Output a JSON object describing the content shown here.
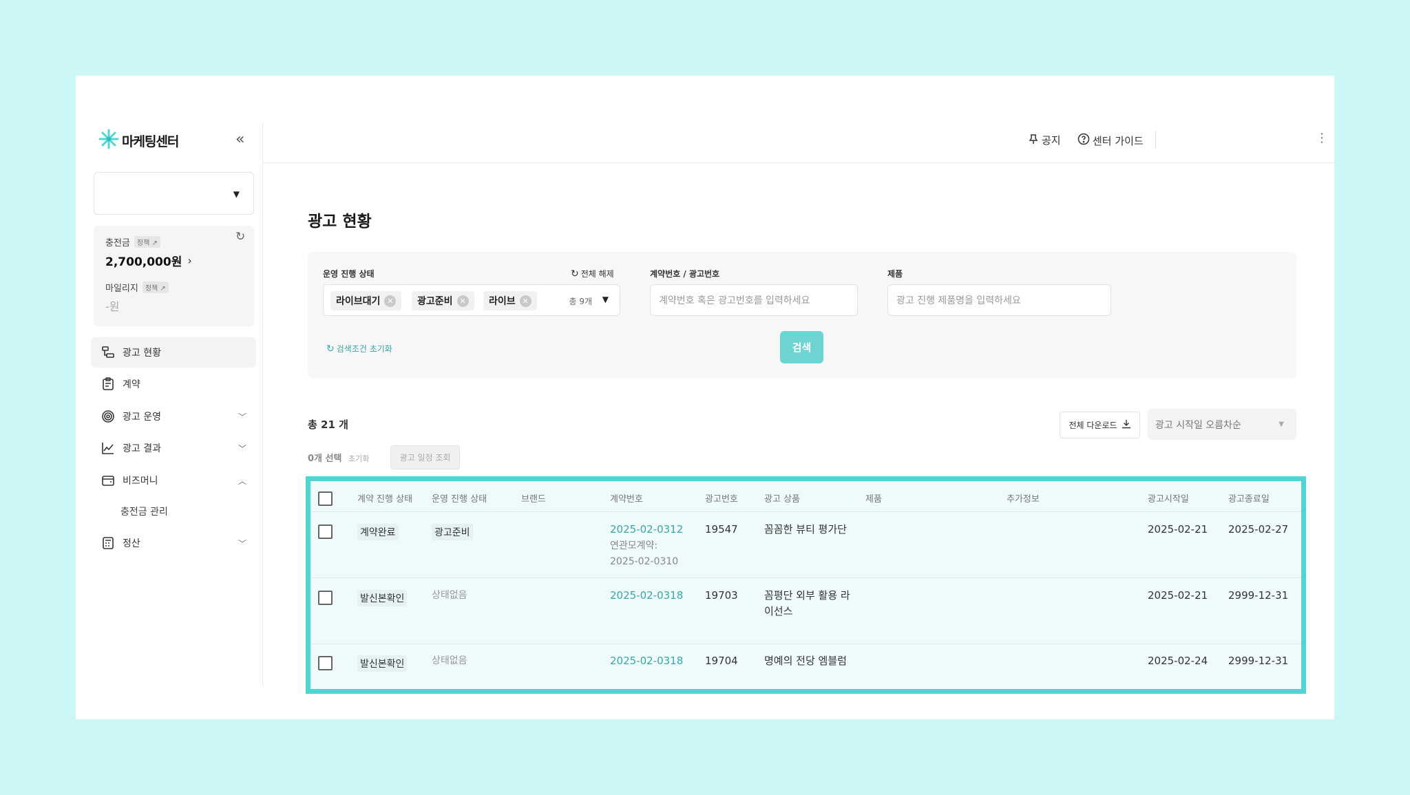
{
  "app": {
    "logo_text": "마케팅센터",
    "brand_color": "#4fd6d4"
  },
  "header": {
    "notice_label": "공지",
    "guide_label": "센터 가이드"
  },
  "sidebar": {
    "account_select_value": "",
    "balance": {
      "charge_label": "충전금",
      "charge_tag": "정책 ↗",
      "charge_amount": "2,700,000원",
      "mileage_label": "마일리지",
      "mileage_tag": "정책 ↗",
      "mileage_amount": "-원"
    },
    "items": [
      {
        "label": "광고 현황",
        "icon": "ad-status-icon",
        "active": true
      },
      {
        "label": "계약",
        "icon": "clipboard-icon"
      },
      {
        "label": "광고 운영",
        "icon": "target-icon",
        "expandable": true
      },
      {
        "label": "광고 결과",
        "icon": "line-chart-icon",
        "expandable": true
      },
      {
        "label": "비즈머니",
        "icon": "wallet-icon",
        "expanded": true
      },
      {
        "label": "충전금 관리",
        "sub": true
      },
      {
        "label": "정산",
        "icon": "calculator-icon",
        "expandable": true
      }
    ]
  },
  "main": {
    "title": "광고 현황",
    "filters": {
      "status_label": "운영 진행 상태",
      "clear_all_label": "전체 해제",
      "chips": [
        "라이브대기",
        "광고준비",
        "라이브"
      ],
      "chip_count": "총 9개",
      "contract_label": "계약번호 / 광고번호",
      "contract_placeholder": "계약번호 혹은 광고번호를 입력하세요",
      "product_label": "제품",
      "product_placeholder": "광고 진행 제품명을 입력하세요",
      "reset_label": "검색조건 초기화",
      "search_label": "검색"
    },
    "total_label": "총 21 개",
    "download_label": "전체 다운로드",
    "sort_value": "광고 시작일 오름차순",
    "selected_count": "0개 선택",
    "selected_reset": "초기화",
    "schedule_label": "광고 일정 조회"
  },
  "table": {
    "columns": [
      "계약 진행 상태",
      "운영 진행 상태",
      "브랜드",
      "계약번호",
      "광고번호",
      "광고 상품",
      "제품",
      "추가정보",
      "광고시작일",
      "광고종료일"
    ],
    "rows": [
      {
        "contract_status": "계약완료",
        "ops_status": "광고준비",
        "brand": "",
        "contract_no": "2025-02-0312",
        "parent_label": "연관모계약:",
        "parent_no": "2025-02-0310",
        "ad_no": "19547",
        "product": "꼼꼼한 뷰티 평가단",
        "item": "",
        "extra": "",
        "start": "2025-02-21",
        "end": "2025-02-27"
      },
      {
        "contract_status": "발신본확인",
        "ops_status": "상태없음",
        "brand": "",
        "contract_no": "2025-02-0318",
        "ad_no": "19703",
        "product_line1": "꼼평단 외부 활용 라",
        "product_line2": "이선스",
        "item": "",
        "extra": "",
        "start": "2025-02-21",
        "end": "2999-12-31"
      },
      {
        "contract_status": "발신본확인",
        "ops_status": "상태없음",
        "brand": "",
        "contract_no": "2025-02-0318",
        "ad_no": "19704",
        "product": "명예의 전당 엠블럼",
        "item": "",
        "extra": "",
        "start": "2025-02-24",
        "end": "2999-12-31"
      }
    ]
  }
}
